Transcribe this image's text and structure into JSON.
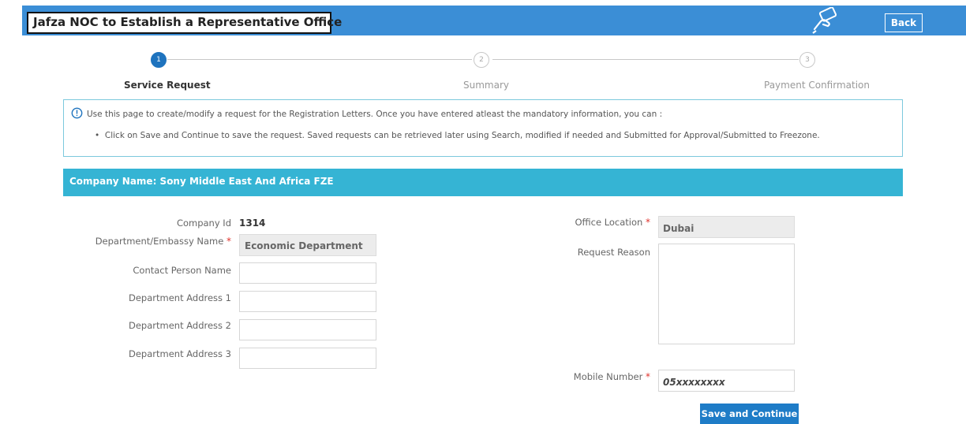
{
  "header": {
    "title": "Jafza NOC to Establish a Representative Office",
    "back_label": "Back"
  },
  "steps": [
    {
      "number": "1",
      "label": "Service Request",
      "active": true
    },
    {
      "number": "2",
      "label": "Summary",
      "active": false
    },
    {
      "number": "3",
      "label": "Payment Confirmation",
      "active": false
    }
  ],
  "info": {
    "line1": "Use this page to create/modify a request for the Registration Letters. Once you have entered atleast the mandatory information, you can :",
    "bullet1": "Click on Save and Continue to save the request. Saved requests can be retrieved later using Search, modified if needed and Submitted for Approval/Submitted to Freezone."
  },
  "company_bar": "Company Name: Sony Middle East And Africa FZE",
  "form": {
    "company_id_label": "Company Id",
    "company_id_value": "1314",
    "department_label": "Department/Embassy Name",
    "department_value": "Economic Department",
    "contact_label": "Contact Person Name",
    "contact_value": "",
    "address1_label": "Department Address 1",
    "address1_value": "",
    "address2_label": "Department Address 2",
    "address2_value": "",
    "address3_label": "Department Address 3",
    "address3_value": "",
    "office_location_label": "Office Location",
    "office_location_value": "Dubai",
    "request_reason_label": "Request Reason",
    "request_reason_value": "",
    "mobile_label": "Mobile Number",
    "mobile_placeholder": "05xxxxxxxx",
    "required_mark": "*"
  },
  "actions": {
    "save_continue_label": "Save and Continue"
  },
  "colors": {
    "topbar": "#3b8ed6",
    "company_bar": "#35b4d4",
    "step_active": "#1e73be",
    "required": "#e0322c",
    "save_button": "#1e7cc7"
  },
  "icons": [
    "hand-card-icon",
    "info-circle-icon"
  ]
}
